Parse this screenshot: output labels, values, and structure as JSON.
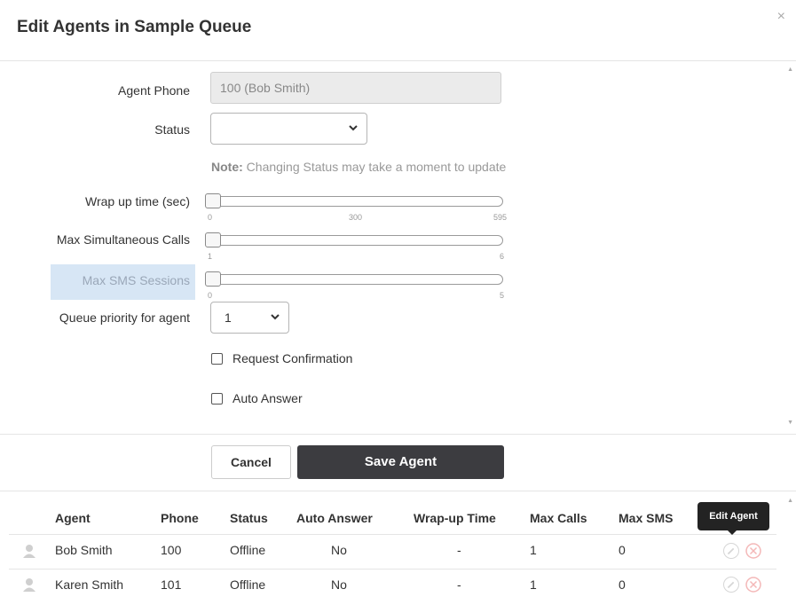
{
  "dialog": {
    "title": "Edit Agents in Sample Queue",
    "close_symbol": "×"
  },
  "form": {
    "agent_phone_label": "Agent Phone",
    "agent_phone_value": "100 (Bob Smith)",
    "status_label": "Status",
    "status_value": "",
    "note_prefix": "Note:",
    "note_text": " Changing Status may take a moment to update",
    "wrap_label": "Wrap up time (sec)",
    "wrap_ticks": [
      "0",
      "300",
      "595"
    ],
    "wrap_value": 0,
    "max_calls_label": "Max Simultaneous Calls",
    "max_calls_ticks": [
      "1",
      "6"
    ],
    "max_calls_value": 1,
    "max_sms_label": "Max SMS Sessions",
    "max_sms_ticks": [
      "0",
      "5"
    ],
    "max_sms_value": 0,
    "priority_label": "Queue priority for agent",
    "priority_value": "1",
    "request_confirmation_label": "Request Confirmation",
    "request_confirmation_checked": false,
    "auto_answer_label": "Auto Answer",
    "auto_answer_checked": false
  },
  "buttons": {
    "cancel": "Cancel",
    "save": "Save Agent"
  },
  "table": {
    "headers": {
      "agent": "Agent",
      "phone": "Phone",
      "status": "Status",
      "auto_answer": "Auto Answer",
      "wrap": "Wrap-up Time",
      "max_calls": "Max Calls",
      "max_sms": "Max SMS"
    },
    "rows": [
      {
        "agent": "Bob Smith",
        "phone": "100",
        "status": "Offline",
        "auto_answer": "No",
        "wrap": "-",
        "max_calls": "1",
        "max_sms": "0"
      },
      {
        "agent": "Karen Smith",
        "phone": "101",
        "status": "Offline",
        "auto_answer": "No",
        "wrap": "-",
        "max_calls": "1",
        "max_sms": "0"
      }
    ]
  },
  "tooltip": "Edit Agent",
  "icons": {
    "avatar": "user-icon",
    "edit": "edit-icon",
    "delete": "delete-icon",
    "close": "close-icon",
    "chevron": "chevron-down-icon"
  },
  "colors": {
    "save_button": "#3c3c40",
    "highlight": "#d7e6f5",
    "delete_icon": "#f4b8b8",
    "tooltip": "#232323"
  }
}
